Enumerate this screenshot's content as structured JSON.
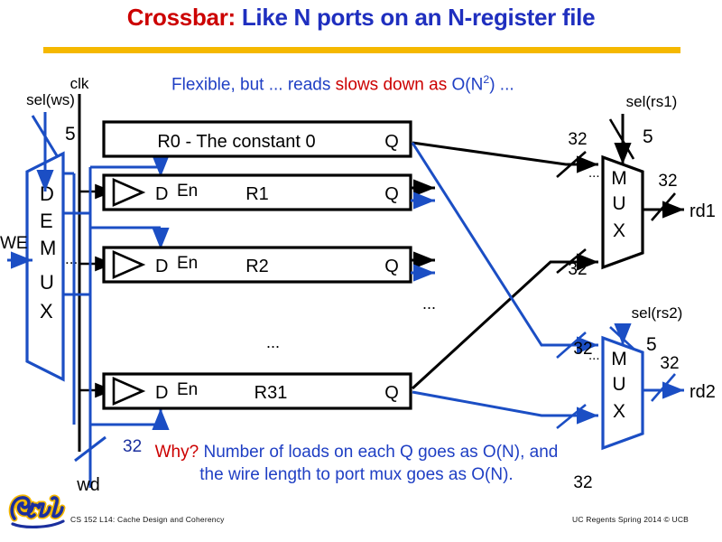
{
  "slide": {
    "title_red": "Crossbar:",
    "title_blue": "Like N ports on an N-register file",
    "rule_color": "#f5b800",
    "header_note": {
      "part1": "Flexible, but ... reads ",
      "part2_red": "slows down as",
      "part3": " O(N",
      "exp": "2",
      "part4": ") ..."
    },
    "bottom_note": {
      "part1_red": "Why?",
      "part2": " Number of loads on each Q goes as O(N), and the wire length to port mux goes as O(N)."
    },
    "footer": "CS 152 L14:  Cache Design and Coherency",
    "copyright": "UC Regents Spring 2014 © UCB",
    "logo_alt": "Cal"
  },
  "colors": {
    "black": "#000000",
    "blue": "#1b4ec4",
    "title_red": "#cc0000",
    "title_blue": "#1f2fbf",
    "gold": "#f5b800"
  },
  "diagram": {
    "clk_label": "clk",
    "sel_ws_label": "sel(ws)",
    "sel_ws_width": "5",
    "we_label": "WE",
    "wd_label": "wd",
    "wd_width": "32",
    "demux_letters": "DEMUX",
    "demux_ellipsis": "...",
    "registers": [
      {
        "name": "R0 - The constant 0",
        "d_label": "",
        "en_label": "",
        "q_label": "Q",
        "has_clock_triangle": false
      },
      {
        "name": "R1",
        "d_label": "D",
        "en_label": "En",
        "q_label": "Q",
        "has_clock_triangle": true
      },
      {
        "name": "R2",
        "d_label": "D",
        "en_label": "En",
        "q_label": "Q",
        "has_clock_triangle": true
      },
      {
        "name": "R31",
        "d_label": "D",
        "en_label": "En",
        "q_label": "Q",
        "has_clock_triangle": true
      }
    ],
    "register_ellipsis_mid": "...",
    "register_ellipsis_col": "...",
    "mux_rs1": {
      "letters": "MUX",
      "sel_label": "sel(rs1)",
      "sel_width": "5",
      "in_width_top": "32",
      "in_width_bottom": "32",
      "out_width": "32",
      "out_label": "rd1",
      "in_ellipsis": "..."
    },
    "mux_rs2": {
      "letters": "MUX",
      "sel_label": "sel(rs2)",
      "sel_width": "5",
      "in_width_top": "32",
      "in_width_bottom": "32",
      "out_width": "32",
      "out_label": "rd2",
      "in_ellipsis": "..."
    }
  }
}
